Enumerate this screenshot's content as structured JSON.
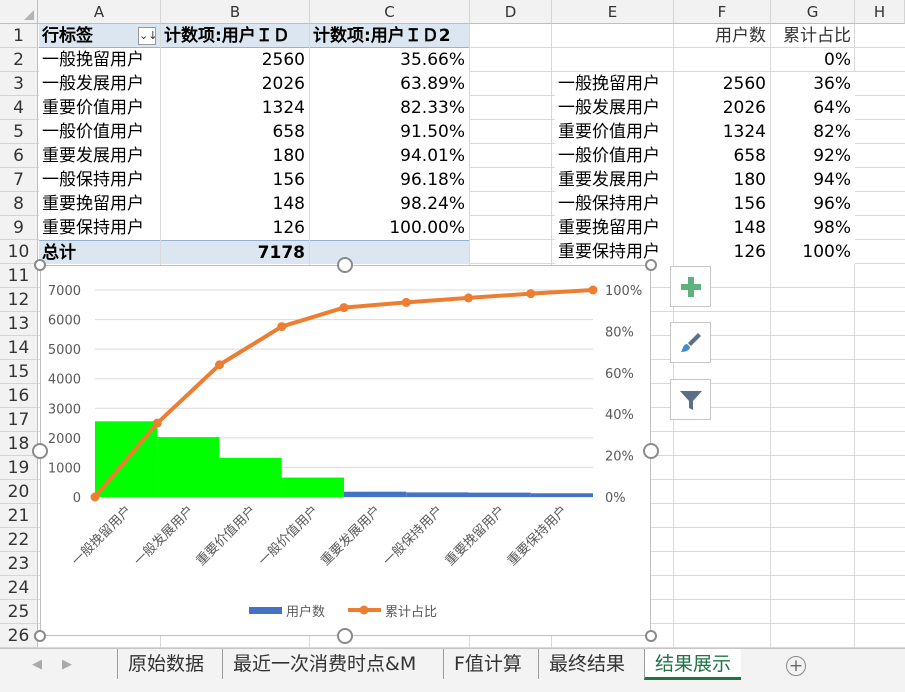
{
  "columns": [
    "A",
    "B",
    "C",
    "D",
    "E",
    "F",
    "G",
    "H"
  ],
  "rows": [
    "1",
    "2",
    "3",
    "4",
    "5",
    "6",
    "7",
    "8",
    "9",
    "10",
    "11",
    "12",
    "13",
    "14",
    "15",
    "16",
    "17",
    "18",
    "19",
    "20",
    "21",
    "22",
    "23",
    "24",
    "25",
    "26"
  ],
  "pivot": {
    "header": {
      "label": "行标签",
      "count_id": "计数项:用户ＩＤ",
      "count_id2": "计数项:用户ＩＤ2"
    },
    "rows": [
      {
        "label": "一般挽留用户",
        "count": "2560",
        "pct": "35.66%"
      },
      {
        "label": "一般发展用户",
        "count": "2026",
        "pct": "63.89%"
      },
      {
        "label": "重要价值用户",
        "count": "1324",
        "pct": "82.33%"
      },
      {
        "label": "一般价值用户",
        "count": "658",
        "pct": "91.50%"
      },
      {
        "label": "重要发展用户",
        "count": "180",
        "pct": "94.01%"
      },
      {
        "label": "一般保持用户",
        "count": "156",
        "pct": "96.18%"
      },
      {
        "label": "重要挽留用户",
        "count": "148",
        "pct": "98.24%"
      },
      {
        "label": "重要保持用户",
        "count": "126",
        "pct": "100.00%"
      }
    ],
    "total": {
      "label": "总计",
      "count": "7178"
    }
  },
  "table2": {
    "header": {
      "users": "用户数",
      "cum": "累计占比"
    },
    "first_cum": "0%",
    "rows": [
      {
        "label": "一般挽留用户",
        "users": "2560",
        "cum": "36%"
      },
      {
        "label": "一般发展用户",
        "users": "2026",
        "cum": "64%"
      },
      {
        "label": "重要价值用户",
        "users": "1324",
        "cum": "82%"
      },
      {
        "label": "一般价值用户",
        "users": "658",
        "cum": "92%"
      },
      {
        "label": "重要发展用户",
        "users": "180",
        "cum": "94%"
      },
      {
        "label": "一般保持用户",
        "users": "156",
        "cum": "96%"
      },
      {
        "label": "重要挽留用户",
        "users": "148",
        "cum": "98%"
      },
      {
        "label": "重要保持用户",
        "users": "126",
        "cum": "100%"
      }
    ]
  },
  "chart_data": {
    "type": "bar",
    "title": "",
    "categories": [
      "一般挽留用户",
      "一般发展用户",
      "重要价值用户",
      "一般价值用户",
      "重要发展用户",
      "一般保持用户",
      "重要挽留用户",
      "重要保持用户"
    ],
    "series": [
      {
        "name": "用户数",
        "type": "bar",
        "axis": "left",
        "values": [
          2560,
          2026,
          1324,
          658,
          180,
          156,
          148,
          126
        ],
        "legend_color": "#4472c4",
        "colors": [
          "#00ff00",
          "#00ff00",
          "#00ff00",
          "#00ff00",
          "#4472c4",
          "#4472c4",
          "#4472c4",
          "#4472c4"
        ]
      },
      {
        "name": "累计占比",
        "type": "line",
        "axis": "right",
        "color": "#ed7d31",
        "x": [
          0,
          1,
          2,
          3,
          4,
          5,
          6,
          7,
          8
        ],
        "values": [
          0,
          0.3566,
          0.6389,
          0.8233,
          0.915,
          0.9401,
          0.9618,
          0.9824,
          1.0
        ]
      }
    ],
    "ylim_left": [
      0,
      7000
    ],
    "yticks_left": [
      "0",
      "1000",
      "2000",
      "3000",
      "4000",
      "5000",
      "6000",
      "7000"
    ],
    "ylim_right": [
      0,
      1
    ],
    "yticks_right": [
      "0%",
      "20%",
      "40%",
      "60%",
      "80%",
      "100%"
    ],
    "grid": true,
    "legend_position": "bottom"
  },
  "chart_tools": {
    "add_icon": "plus-icon",
    "style_icon": "brush-icon",
    "filter_icon": "filter-icon"
  },
  "tabs": [
    "原始数据",
    "最近一次消费时点&M",
    "F值计算",
    "最终结果",
    "结果展示"
  ],
  "active_tab": "结果展示",
  "colors": {
    "accent": "#217346",
    "pivot_bg": "#dce6f1",
    "bar_green": "#00ff00",
    "bar_blue": "#4472c4",
    "line_orange": "#ed7d31"
  }
}
